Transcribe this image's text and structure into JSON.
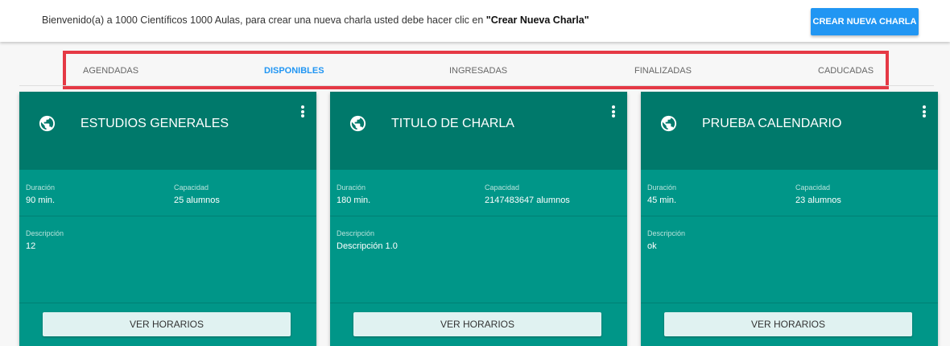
{
  "header": {
    "welcome_text": "Bienvenido(a) a 1000 Científicos 1000 Aulas, para crear una nueva charla usted debe hacer clic en ",
    "welcome_link_quote_open": "\"",
    "welcome_bold": "Crear Nueva Charla",
    "welcome_link_quote_close": "\"",
    "create_button": "CREAR NUEVA CHARLA"
  },
  "tabs": [
    {
      "label": "AGENDADAS",
      "active": false
    },
    {
      "label": "DISPONIBLES",
      "active": true
    },
    {
      "label": "INGRESADAS",
      "active": false
    },
    {
      "label": "FINALIZADAS",
      "active": false
    },
    {
      "label": "CADUCADAS",
      "active": false
    }
  ],
  "labels": {
    "duration": "Duración",
    "capacity": "Capacidad",
    "description": "Descripción",
    "schedule_button": "VER HORARIOS"
  },
  "cards": [
    {
      "title": "ESTUDIOS GENERALES",
      "duration": "90 min.",
      "capacity": "25 alumnos",
      "description": "12"
    },
    {
      "title": "TITULO DE CHARLA",
      "duration": "180 min.",
      "capacity": "2147483647 alumnos",
      "description": "Descripción 1.0"
    },
    {
      "title": "PRUEBA CALENDARIO",
      "duration": "45 min.",
      "capacity": "23 alumnos",
      "description": "ok"
    }
  ],
  "colors": {
    "accent": "#2196f3",
    "card_header": "#00796b",
    "card_body": "#009688",
    "highlight_box": "#e53945"
  }
}
